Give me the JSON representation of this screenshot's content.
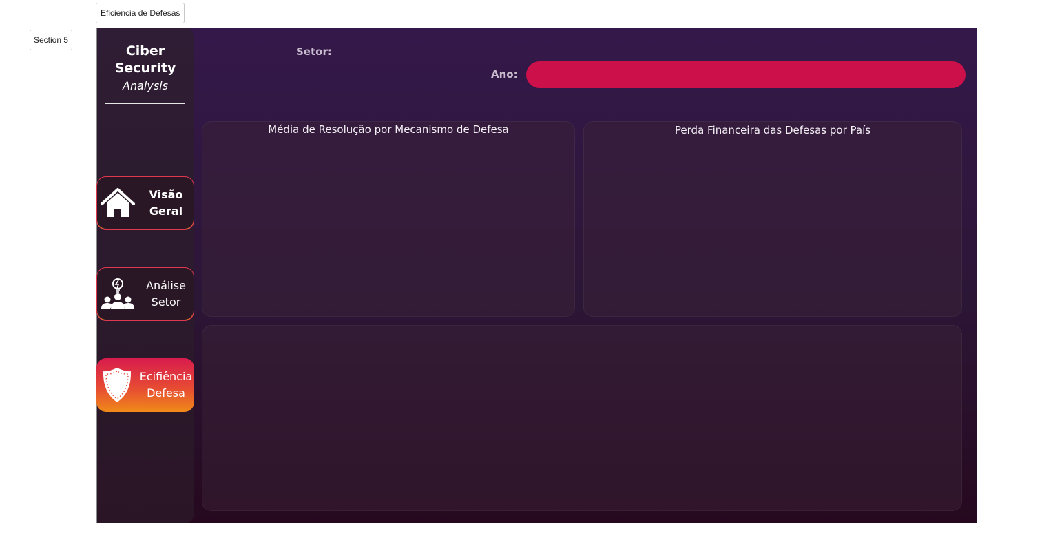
{
  "page_tab": "Eficiencia de Defesas",
  "section_tab": "Section 5",
  "brand": {
    "line1": "Ciber",
    "line2": "Security",
    "line3": "Analysis"
  },
  "nav": [
    {
      "label_line1": "Visão",
      "label_line2": "Geral",
      "icon": "home-icon"
    },
    {
      "label_line1": "Análise",
      "label_line2": "Setor",
      "icon": "team-idea-icon"
    },
    {
      "label_line1": "Ecifiência",
      "label_line2": "Defesa",
      "icon": "shield-icon"
    }
  ],
  "filters": {
    "sector_label": "Setor:",
    "year_label": "Ano:"
  },
  "cards": {
    "left_title": "Média de Resolução por Mecanismo de Defesa",
    "right_title": "Perda Financeira das Defesas por País"
  },
  "colors": {
    "accent": "#cc1049",
    "active_gradient_start": "#d81c4e",
    "active_gradient_end": "#f08a1a"
  }
}
